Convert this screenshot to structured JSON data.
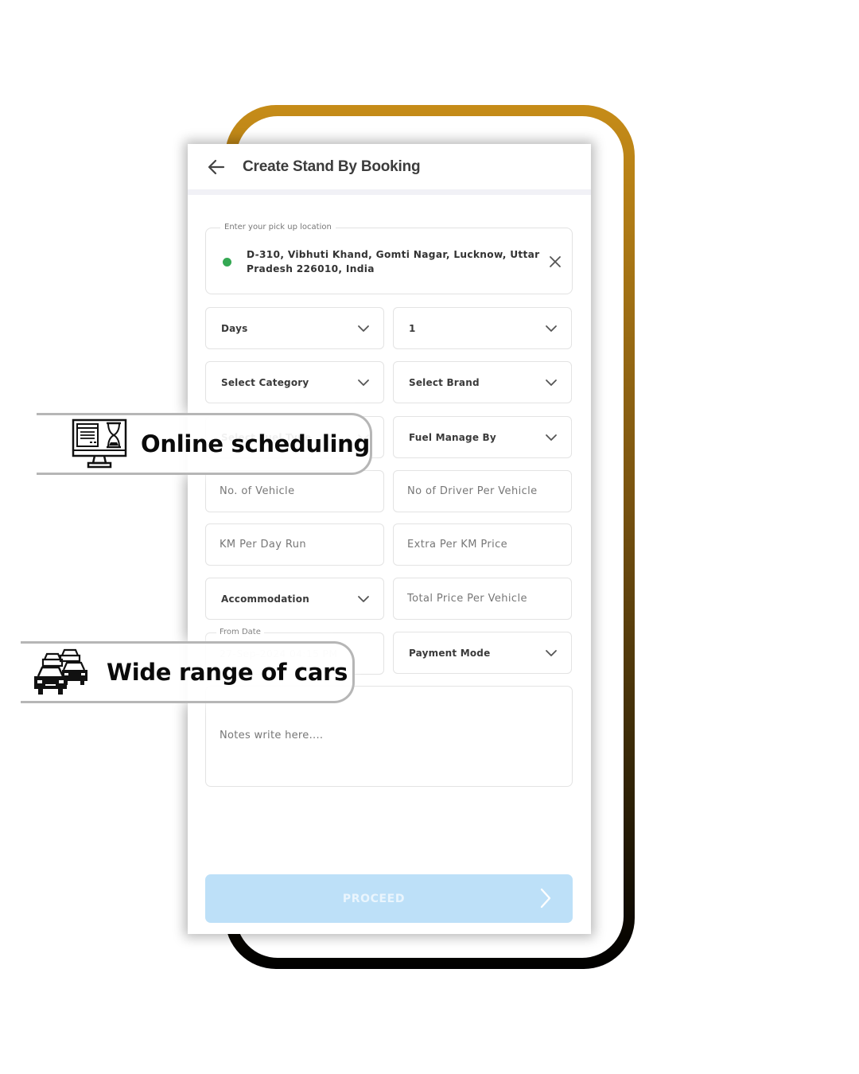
{
  "header": {
    "title": "Create Stand By Booking",
    "back_icon": "arrow-left-icon"
  },
  "pickup": {
    "label": "Enter your pick up location",
    "value": "D-310, Vibhuti Khand, Gomti Nagar, Lucknow, Uttar Pradesh 226010, India",
    "status_color": "#34a853",
    "clear_icon": "close-icon"
  },
  "form": {
    "duration_unit": "Days",
    "duration_value": "1",
    "category": "Select Category",
    "brand": "Select Brand",
    "fuel_type": "Select Fuel Type",
    "fuel_manage_by": "Fuel Manage By",
    "no_of_vehicle_placeholder": "No. of Vehicle",
    "drivers_per_vehicle_placeholder": "No of Driver Per Vehicle",
    "km_per_day_placeholder": "KM Per Day Run",
    "extra_per_km_placeholder": "Extra Per KM Price",
    "accommodation": "Accommodation",
    "total_price_placeholder": "Total Price Per Vehicle",
    "from_date_label": "From Date",
    "from_date_value": "27-Sep-2024 04:15 PM",
    "payment_mode": "Payment Mode",
    "notes_placeholder": "Notes write here...."
  },
  "proceed": {
    "label": "PROCEED",
    "color": "#bde0f8"
  },
  "features": [
    {
      "icon": "monitor-hourglass-icon",
      "label": "Online scheduling"
    },
    {
      "icon": "cars-traffic-icon",
      "label": "Wide range of cars"
    }
  ],
  "theme": {
    "frame_gradient_top": "#c68c18",
    "frame_gradient_bottom": "#000000"
  }
}
